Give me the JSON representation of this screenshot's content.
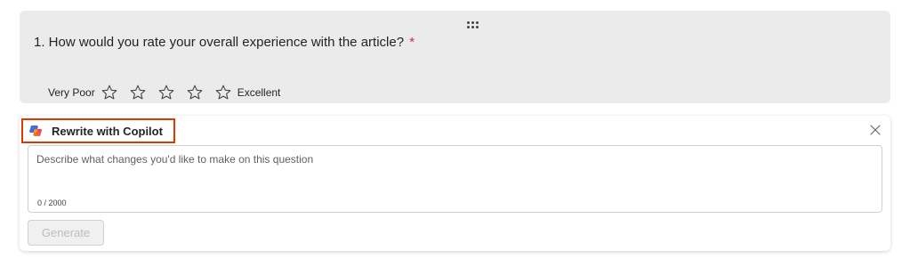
{
  "question": {
    "number_title": "1. How would you rate your overall experience with the article?",
    "required_marker": "*",
    "rating": {
      "low_label": "Very Poor",
      "high_label": "Excellent",
      "star_count": 5,
      "selected": 0
    }
  },
  "copilot": {
    "title": "Rewrite with Copilot",
    "input_placeholder": "Describe what changes you'd like to make on this question",
    "input_value": "",
    "char_count": "0 / 2000",
    "generate_label": "Generate",
    "highlight_color": "#d83b01"
  },
  "colors": {
    "card_background": "#ebebeb",
    "required": "#c4314b"
  },
  "icons": {
    "drag": "drag-handle-icon",
    "star": "star-outline-icon",
    "logo": "copilot-logo-icon",
    "close": "close-icon"
  }
}
